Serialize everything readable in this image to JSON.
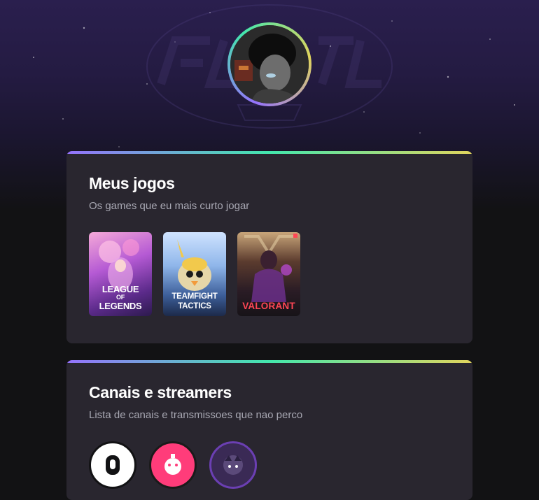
{
  "profile": {
    "avatar_icon": "user-avatar",
    "ring_colors": [
      "#9572fc",
      "#43e7ad",
      "#e1d55d"
    ]
  },
  "games_section": {
    "title": "Meus jogos",
    "subtitle": "Os games que eu mais curto jogar",
    "games": [
      {
        "line1": "LEAGUE",
        "line2": "LEGENDS",
        "small": "OF"
      },
      {
        "line1": "TEAMFIGHT",
        "line2": "TACTICS"
      },
      {
        "line1": "VALORANT"
      }
    ]
  },
  "streamers_section": {
    "title": "Canais e streamers",
    "subtitle": "Lista de canais e transmissoes que nao perco"
  },
  "colors": {
    "background": "#121214",
    "card": "#29262f",
    "accent_purple": "#9572fc",
    "accent_green": "#43e7ad",
    "accent_yellow": "#e1d55d",
    "valorant_red": "#ff4655"
  }
}
